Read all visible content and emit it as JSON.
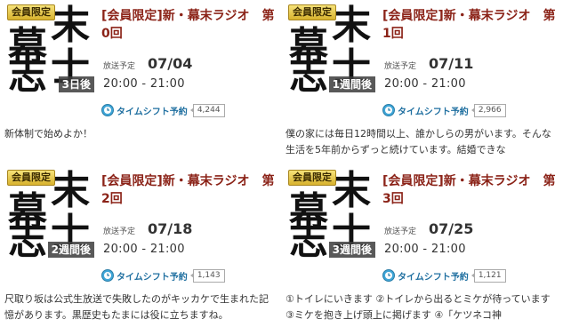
{
  "programs": [
    {
      "badge": "会員限定",
      "thumb_chars": [
        "幕",
        "末",
        "志",
        "士"
      ],
      "until": "3日後",
      "title": "[会員限定]新・幕末ラジオ　第0回",
      "sched_label": "放送予定",
      "sched_date": "07/04",
      "sched_time": "20:00 - 21:00",
      "timeshift_label": "タイムシフト予約",
      "count": "4,244",
      "description": "新体制で始めよか！"
    },
    {
      "badge": "会員限定",
      "thumb_chars": [
        "幕",
        "末",
        "志",
        "士"
      ],
      "until": "1週間後",
      "title": "[会員限定]新・幕末ラジオ　第1回",
      "sched_label": "放送予定",
      "sched_date": "07/11",
      "sched_time": "20:00 - 21:00",
      "timeshift_label": "タイムシフト予約",
      "count": "2,966",
      "description": "僕の家には毎日12時間以上、誰かしらの男がいます。そんな生活を5年前からずっと続けています。結婚できな"
    },
    {
      "badge": "会員限定",
      "thumb_chars": [
        "幕",
        "末",
        "志",
        "士"
      ],
      "until": "2週間後",
      "title": "[会員限定]新・幕末ラジオ　第2回",
      "sched_label": "放送予定",
      "sched_date": "07/18",
      "sched_time": "20:00 - 21:00",
      "timeshift_label": "タイムシフト予約",
      "count": "1,143",
      "description": "尺取り坂は公式生放送で失敗したのがキッカケで生まれた記憶があります。黒歴史もたまには役に立ちますね。"
    },
    {
      "badge": "会員限定",
      "thumb_chars": [
        "幕",
        "末",
        "志",
        "士"
      ],
      "until": "3週間後",
      "title": "[会員限定]新・幕末ラジオ　第3回",
      "sched_label": "放送予定",
      "sched_date": "07/25",
      "sched_time": "20:00 - 21:00",
      "timeshift_label": "タイムシフト予約",
      "count": "1,121",
      "description": "①トイレにいきます ②トイレから出るとミケが待っています ③ミケを抱き上げ頭上に掲げます ④「ケツネコ神"
    }
  ]
}
